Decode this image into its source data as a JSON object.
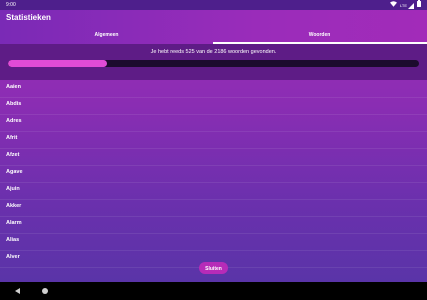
{
  "status_bar": {
    "time": "9:00",
    "icons": [
      "wifi-icon",
      "lte-signal-icon",
      "battery-icon"
    ],
    "signal_label": "LTE"
  },
  "app": {
    "title": "Statistieken",
    "tabs": [
      {
        "label": "Algemeen",
        "selected": false
      },
      {
        "label": "Woorden",
        "selected": true
      }
    ],
    "progress": {
      "text": "Je hebt reeds 525 van de 2186 woorden gevonden.",
      "found": 525,
      "total": 2186,
      "fraction": 0.24
    },
    "words": [
      "Aaien",
      "Abdis",
      "Adres",
      "Afrit",
      "Afzet",
      "Agave",
      "Ajuin",
      "Akker",
      "Alarm",
      "Alias",
      "Alver"
    ],
    "close_button": "Sluiten"
  },
  "colors": {
    "accent": "#e04bd6",
    "app_bar": "#9a2cba",
    "background_top": "#9e2cb8",
    "background_bottom": "#5a34a8",
    "progress_panel": "#5e1c86",
    "progress_track": "#1c0b2e",
    "button": "#b72bb8"
  },
  "nav_bar": {
    "icons": [
      "back-icon",
      "home-icon"
    ]
  }
}
